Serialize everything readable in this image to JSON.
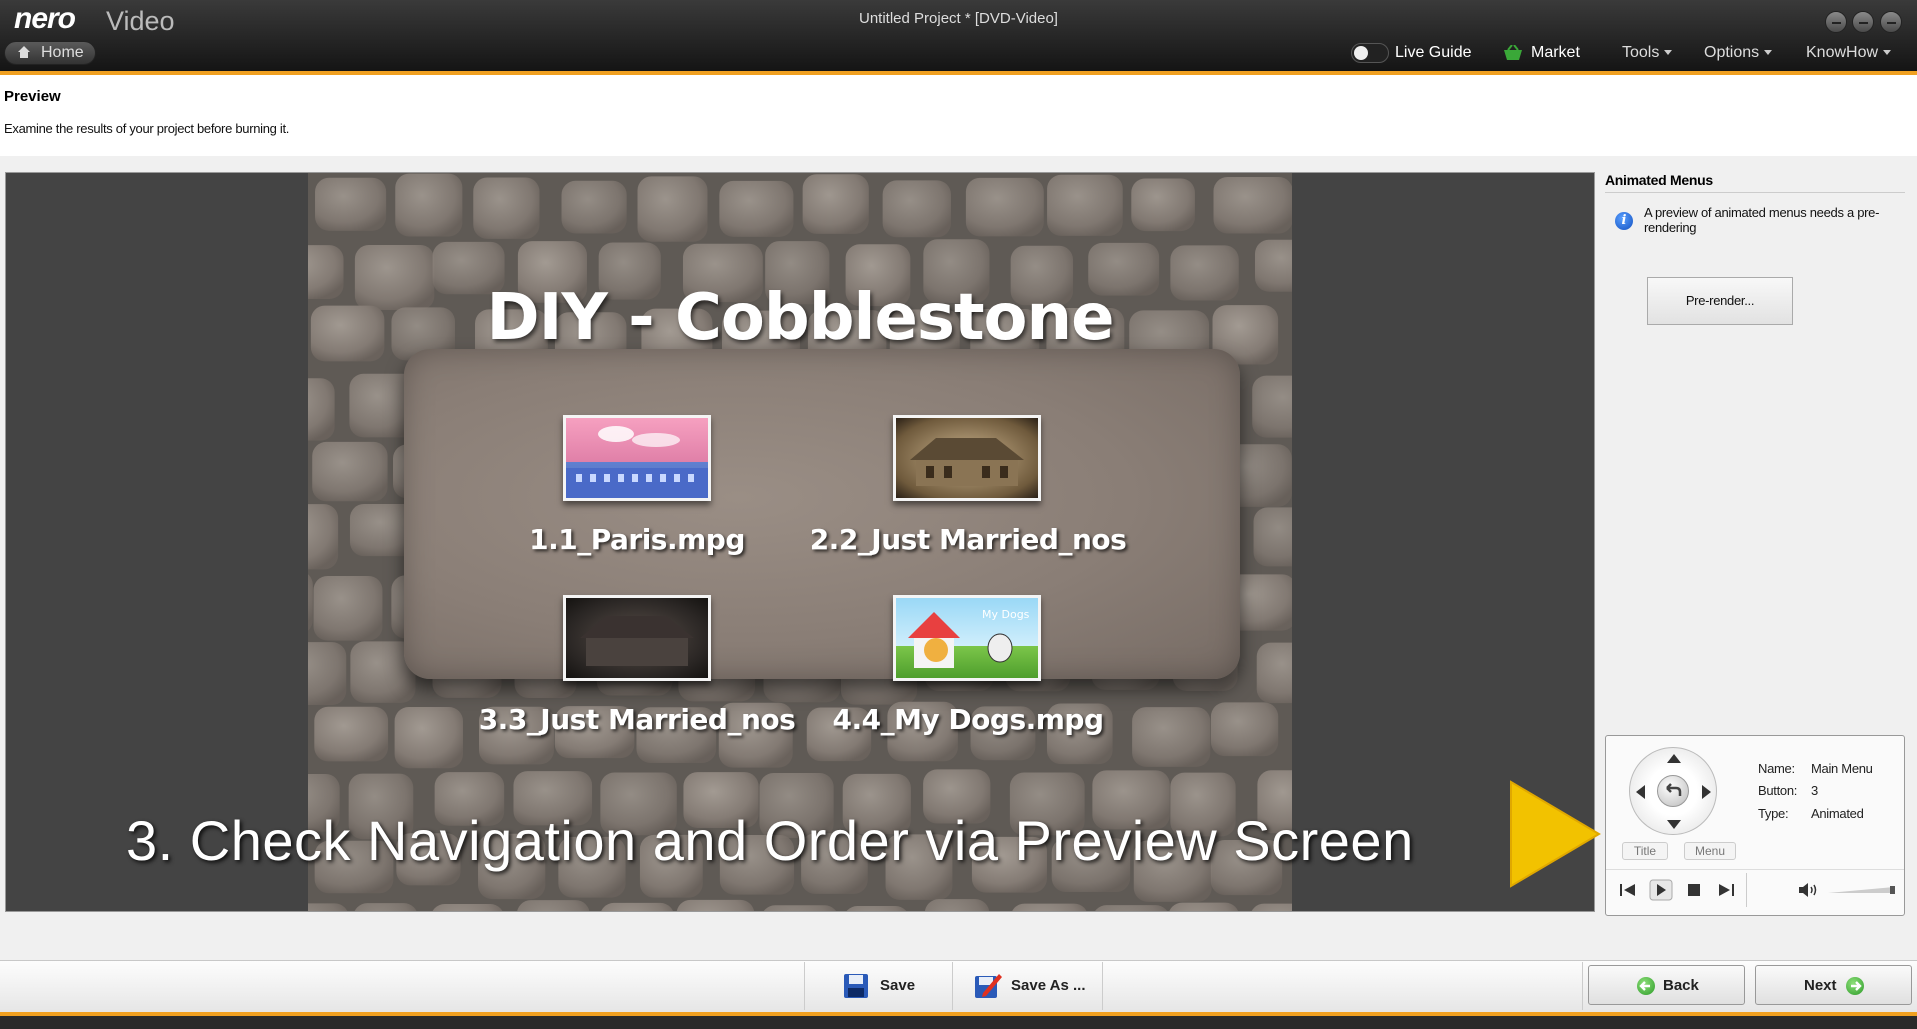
{
  "app": {
    "logo": "nero",
    "product": "Video",
    "window_title": "Untitled Project * [DVD-Video]",
    "home_label": "Home"
  },
  "top_menu": {
    "live_guide": "Live Guide",
    "market": "Market",
    "tools": "Tools",
    "options": "Options",
    "knowhow": "KnowHow"
  },
  "header": {
    "title": "Preview",
    "description": "Examine the results of your project before burning it."
  },
  "preview": {
    "menu_title": "DIY - Cobblestone",
    "items": [
      {
        "label": "1.1_Paris.mpg"
      },
      {
        "label": "2.2_Just Married_nos"
      },
      {
        "label": "3.3_Just Married_nos"
      },
      {
        "label": "4.4_My Dogs.mpg",
        "thumb_text": "My Dogs"
      }
    ],
    "caption": "3. Check Navigation and Order via Preview Screen"
  },
  "right_panel": {
    "title": "Animated Menus",
    "info": "A preview of animated menus needs a pre-rendering",
    "prerender_label": "Pre-render..."
  },
  "remote": {
    "name_label": "Name:",
    "name_value": "Main Menu",
    "button_label": "Button:",
    "button_value": "3",
    "type_label": "Type:",
    "type_value": "Animated",
    "title_btn": "Title",
    "menu_btn": "Menu"
  },
  "bottom": {
    "save": "Save",
    "save_as": "Save As ...",
    "back": "Back",
    "next": "Next"
  },
  "colors": {
    "accent_orange": "#f0a020",
    "arrow_yellow": "#f2c200",
    "nav_green": "#2c9a28"
  }
}
